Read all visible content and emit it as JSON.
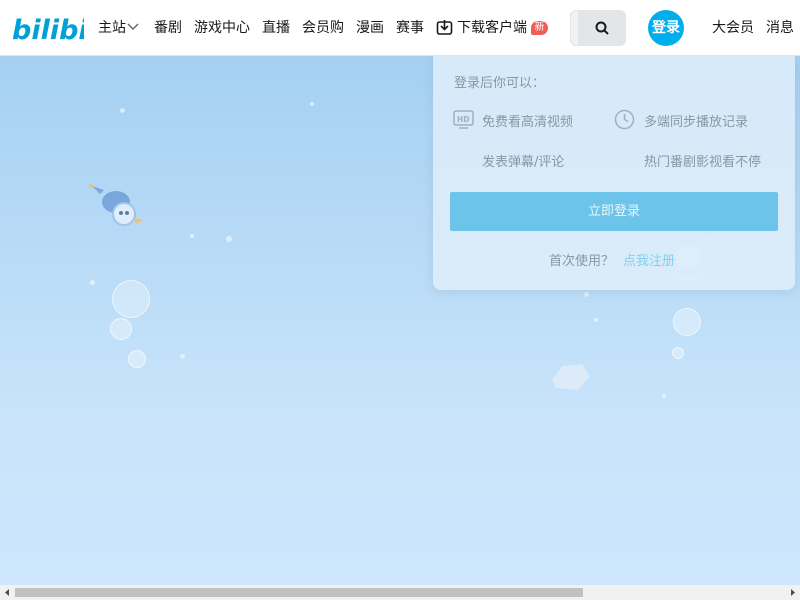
{
  "header": {
    "logo_name": "bilibili",
    "nav": [
      {
        "label": "主站"
      },
      {
        "label": "番剧"
      },
      {
        "label": "游戏中心"
      },
      {
        "label": "直播"
      },
      {
        "label": "会员购"
      },
      {
        "label": "漫画"
      },
      {
        "label": "赛事"
      },
      {
        "label": "下载客户端"
      }
    ],
    "new_badge": "新",
    "login_label": "登录",
    "right_links": [
      {
        "label": "大会员"
      },
      {
        "label": "消息"
      }
    ],
    "icons": {
      "chevron": "chevron-down-icon",
      "download": "download-icon",
      "search": "search-icon"
    }
  },
  "login_popup": {
    "title": "登录后你可以：",
    "features": [
      {
        "label": "免费看高清视频",
        "icon": "hd-icon"
      },
      {
        "label": "多端同步播放记录",
        "icon": "clock-icon"
      },
      {
        "label": "发表弹幕/评论",
        "icon": "danmaku-icon"
      },
      {
        "label": "热门番剧影视看不停",
        "icon": "tv-icon"
      }
    ],
    "button_label": "立即登录",
    "first_use_text": "首次使用？",
    "register_link": "点我注册"
  },
  "colors": {
    "brand": "#00aeec",
    "new_badge": "#f25d59",
    "header_bg": "#ffffff",
    "popup_button": "#6cc4ea"
  }
}
